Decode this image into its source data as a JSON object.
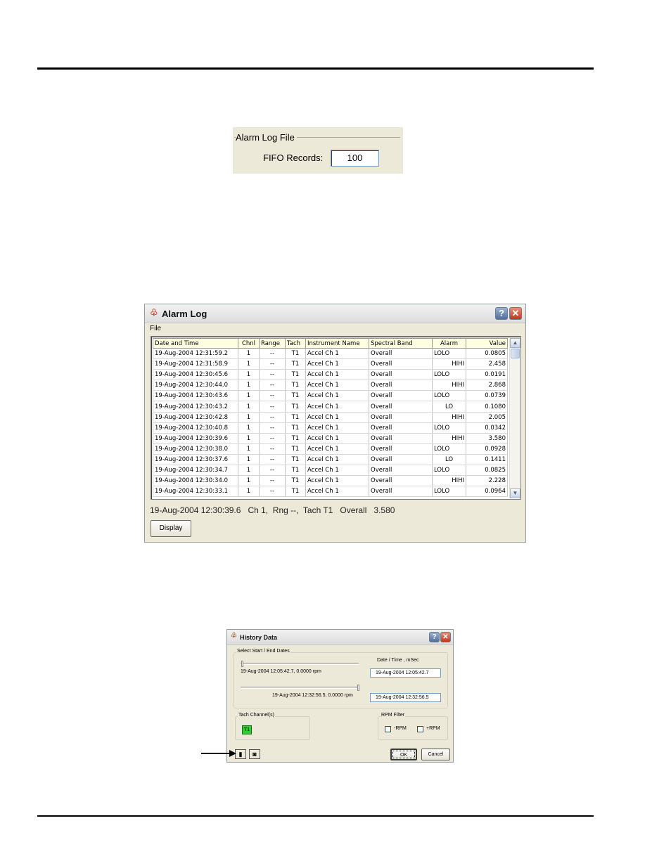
{
  "alarm_log_file": {
    "legend": "Alarm Log File",
    "fifo_label": "FIFO Records:",
    "fifo_value": "100"
  },
  "alarm_log": {
    "title": "Alarm Log",
    "menu_file": "File",
    "columns": [
      "Date and Time",
      "Chnl",
      "Range",
      "Tach",
      "Instrument Name",
      "Spectral Band",
      "Alarm",
      "Value"
    ],
    "rows": [
      [
        "19-Aug-2004 12:31:59.2",
        "1",
        "--",
        "T1",
        "Accel Ch  1",
        "Overall",
        "LOLO",
        "0.0805"
      ],
      [
        "19-Aug-2004 12:31:58.9",
        "1",
        "--",
        "T1",
        "Accel Ch  1",
        "Overall",
        "HIHI",
        "2.458"
      ],
      [
        "19-Aug-2004 12:30:45.6",
        "1",
        "--",
        "T1",
        "Accel Ch  1",
        "Overall",
        "LOLO",
        "0.0191"
      ],
      [
        "19-Aug-2004 12:30:44.0",
        "1",
        "--",
        "T1",
        "Accel Ch  1",
        "Overall",
        "HIHI",
        "2.868"
      ],
      [
        "19-Aug-2004 12:30:43.6",
        "1",
        "--",
        "T1",
        "Accel Ch  1",
        "Overall",
        "LOLO",
        "0.0739"
      ],
      [
        "19-Aug-2004 12:30:43.2",
        "1",
        "--",
        "T1",
        "Accel Ch  1",
        "Overall",
        "LO",
        "0.1080"
      ],
      [
        "19-Aug-2004 12:30:42.8",
        "1",
        "--",
        "T1",
        "Accel Ch  1",
        "Overall",
        "HIHI",
        "2.005"
      ],
      [
        "19-Aug-2004 12:30:40.8",
        "1",
        "--",
        "T1",
        "Accel Ch  1",
        "Overall",
        "LOLO",
        "0.0342"
      ],
      [
        "19-Aug-2004 12:30:39.6",
        "1",
        "--",
        "T1",
        "Accel Ch  1",
        "Overall",
        "HIHI",
        "3.580"
      ],
      [
        "19-Aug-2004 12:30:38.0",
        "1",
        "--",
        "T1",
        "Accel Ch  1",
        "Overall",
        "LOLO",
        "0.0928"
      ],
      [
        "19-Aug-2004 12:30:37.6",
        "1",
        "--",
        "T1",
        "Accel Ch  1",
        "Overall",
        "LO",
        "0.1411"
      ],
      [
        "19-Aug-2004 12:30:34.7",
        "1",
        "--",
        "T1",
        "Accel Ch  1",
        "Overall",
        "LOLO",
        "0.0825"
      ],
      [
        "19-Aug-2004 12:30:34.0",
        "1",
        "--",
        "T1",
        "Accel Ch  1",
        "Overall",
        "HIHI",
        "2.228"
      ],
      [
        "19-Aug-2004 12:30:33.1",
        "1",
        "--",
        "T1",
        "Accel Ch  1",
        "Overall",
        "LOLO",
        "0.0964"
      ]
    ],
    "status": "19-Aug-2004 12:30:39.6   Ch 1,  Rng --,  Tach T1   Overall   3.580",
    "display_button": "Display"
  },
  "history_data": {
    "title": "History Data",
    "dates_group": "Select Start / End Dates",
    "date_time_label": "Date / Time , mSec",
    "start_readout": "19-Aug-2004 12:05:42.7, 0.0000 rpm",
    "end_readout": "19-Aug-2004 12:32:56.5, 0.0000 rpm",
    "start_value": "19-Aug-2004 12:05:42.7",
    "end_value": "19-Aug-2004 12:32:56.5",
    "tach_group": "Tach Channel(s)",
    "tach_button": "T1",
    "rpm_group": "RPM Filter",
    "minus_rpm": "-RPM",
    "plus_rpm": "+RPM",
    "ok": "OK",
    "cancel": "Cancel"
  },
  "colors": {
    "window_face": "#ece9d8",
    "header_fill": "#ffffe1",
    "tach_active": "#33cc33",
    "close_red": "#c2371c"
  }
}
